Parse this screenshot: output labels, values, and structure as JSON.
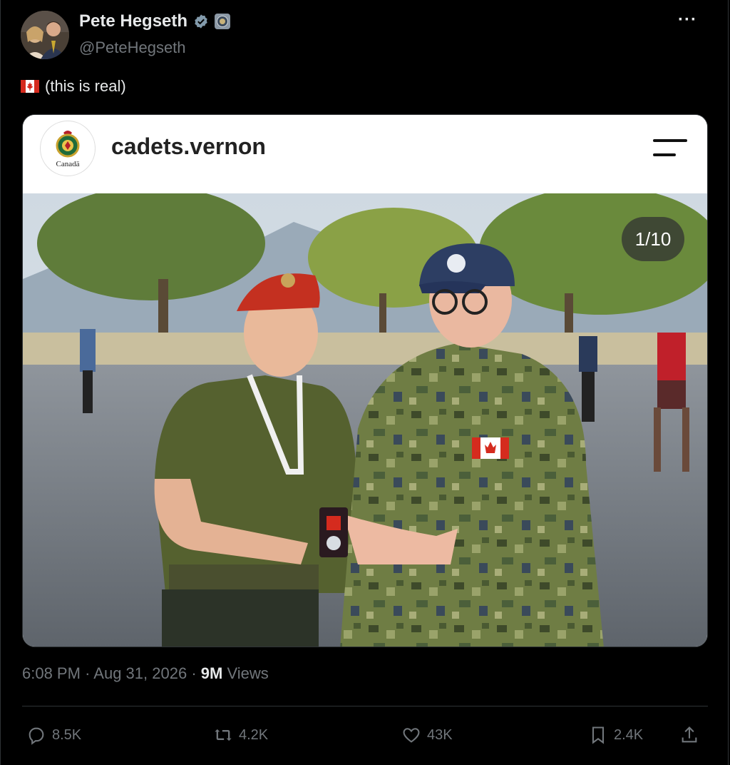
{
  "author": {
    "name": "Pete Hegseth",
    "handle": "@PeteHegseth"
  },
  "tweet": {
    "text": "(this is real)",
    "flag_icon": "canada-flag-icon"
  },
  "embed": {
    "username": "cadets.vernon",
    "logo_text": "Canadä",
    "counter": "1/10"
  },
  "meta": {
    "time": "6:08 PM",
    "separator": "·",
    "date": "Aug 31, 2026",
    "views_count": "9M",
    "views_label": "Views"
  },
  "actions": {
    "replies": "8.5K",
    "reposts": "4.2K",
    "likes": "43K",
    "bookmarks": "2.4K"
  },
  "colors": {
    "background": "#000000",
    "text": "#e7e9ea",
    "muted": "#71767b",
    "divider": "#2f3336",
    "canada_red": "#d52b1e"
  }
}
